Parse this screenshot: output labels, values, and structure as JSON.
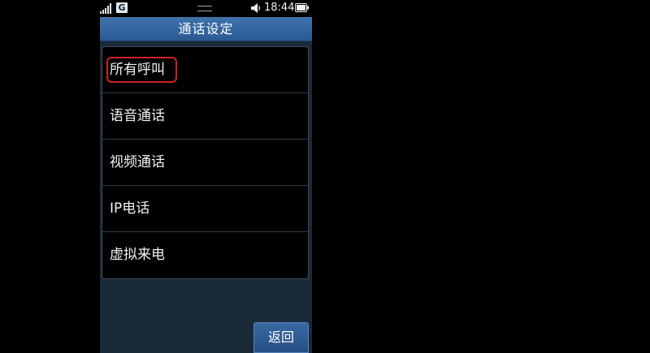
{
  "status_bar": {
    "network": "G",
    "time": "18:44",
    "icons": [
      "signal-icon",
      "drag-handle-icon",
      "speaker-icon",
      "battery-icon"
    ]
  },
  "header": {
    "title": "通话设定"
  },
  "menu": {
    "items": [
      {
        "label": "所有呼叫",
        "highlighted": true
      },
      {
        "label": "语音通话"
      },
      {
        "label": "视频通话"
      },
      {
        "label": "IP电话"
      },
      {
        "label": "虚拟来电"
      }
    ]
  },
  "footer": {
    "back_label": "返回"
  },
  "colors": {
    "accent": "#2f62a0",
    "highlight": "#d02020",
    "list_bg": "#000000",
    "screen_bg": "#1b2a38"
  }
}
